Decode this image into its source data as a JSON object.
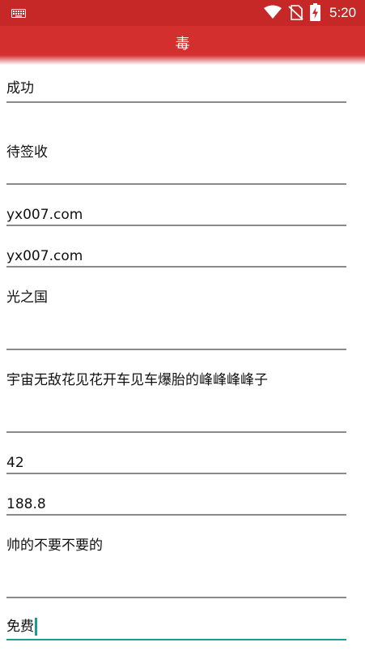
{
  "status_bar": {
    "time": "5:20",
    "icons": [
      "keyboard-icon",
      "wifi-icon",
      "no-sim-icon",
      "battery-charging-icon"
    ]
  },
  "app_bar": {
    "title": "毒",
    "color": "#c62828"
  },
  "fields": [
    {
      "value": "成功"
    },
    {
      "value": "待签收"
    },
    {
      "value": "yx007.com"
    },
    {
      "value": "yx007.com"
    },
    {
      "value": "光之国"
    },
    {
      "value": "宇宙无敌花见花开车见车爆胎的峰峰峰峰子"
    },
    {
      "value": "42"
    },
    {
      "value": "188.8"
    },
    {
      "value": "帅的不要不要的"
    },
    {
      "value": "免费",
      "focused": true
    }
  ],
  "colors": {
    "accent": "#14a090",
    "underline": "#8a8a8a"
  }
}
